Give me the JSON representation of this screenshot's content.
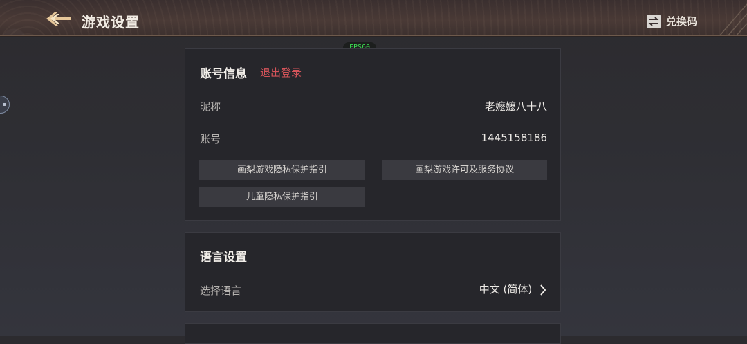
{
  "header": {
    "title": "游戏设置",
    "redeem_label": "兑换码"
  },
  "overlay": {
    "fps": "FPS60"
  },
  "account": {
    "title": "账号信息",
    "logout_label": "退出登录",
    "nickname_label": "昵称",
    "nickname_value": "老嬷嬷八十八",
    "account_label": "账号",
    "account_value": "1445158186",
    "links": [
      "画梨游戏隐私保护指引",
      "画梨游戏许可及服务协议",
      "儿童隐私保护指引"
    ]
  },
  "language": {
    "title": "语言设置",
    "select_label": "选择语言",
    "selected_value": "中文 (简体)"
  },
  "colors": {
    "accent_logout": "#d5545a",
    "fps_green": "#3de054"
  }
}
